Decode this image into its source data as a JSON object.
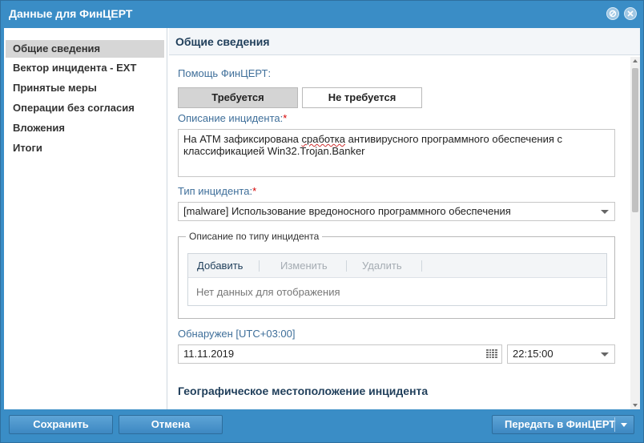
{
  "window": {
    "title": "Данные для ФинЦЕРТ"
  },
  "sidebar": {
    "items": [
      {
        "label": "Общие сведения",
        "active": true
      },
      {
        "label": "Вектор инцидента - EXT"
      },
      {
        "label": "Принятые меры"
      },
      {
        "label": "Операции без согласия"
      },
      {
        "label": "Вложения"
      },
      {
        "label": "Итоги"
      }
    ]
  },
  "content": {
    "header": "Общие сведения",
    "help": {
      "label": "Помощь ФинЦЕРТ:",
      "options": [
        "Требуется",
        "Не требуется"
      ],
      "selected": "Требуется"
    },
    "description": {
      "label": "Описание инцидента:",
      "required_mark": "*",
      "value_before": "На АТМ зафиксирована ",
      "value_squiggle": "сработка",
      "value_after": " антивирусного программного обеспечения с классификацией Win32.Trojan.Banker"
    },
    "incident_type": {
      "label": "Тип инцидента:",
      "required_mark": "*",
      "value": "[malware] Использование вредоносного программного обеспечения"
    },
    "type_description": {
      "legend": "Описание по типу инцидента",
      "toolbar": {
        "add": "Добавить",
        "edit": "Изменить",
        "delete": "Удалить"
      },
      "empty_text": "Нет данных для отображения"
    },
    "detected": {
      "label": "Обнаружен [UTC+03:00]",
      "date": "11.11.2019",
      "time": "22:15:00"
    },
    "geo_header": "Географическое местоположение инцидента"
  },
  "footer": {
    "save": "Сохранить",
    "cancel": "Отмена",
    "send": "Передать в ФинЦЕРТ"
  },
  "colors": {
    "accent": "#3a8dc6",
    "label": "#3f6f9a",
    "required": "#d60000"
  }
}
